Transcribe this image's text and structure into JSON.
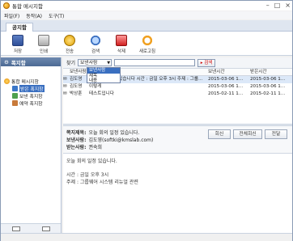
{
  "window": {
    "title": "통합 메시지함",
    "controls": [
      "–",
      "□",
      "×"
    ]
  },
  "menu": [
    "파일(F)",
    "동작(A)",
    "도구(T)"
  ],
  "tabs": [
    {
      "label": "공지함"
    }
  ],
  "toolbar": [
    {
      "label": "저장",
      "icon": "save-icon"
    },
    {
      "label": "인쇄",
      "icon": "print-icon"
    },
    {
      "label": "전송",
      "icon": "send-icon"
    },
    {
      "label": "검색",
      "icon": "search-icon"
    },
    {
      "label": "삭제",
      "icon": "delete-icon"
    },
    {
      "label": "새로고침",
      "icon": "refresh-icon"
    }
  ],
  "sidebar": {
    "title": "폭지함",
    "tree": {
      "root": "통합 메시지함",
      "items": [
        {
          "label": "받은 폭지함",
          "selected": true
        },
        {
          "label": "보낸 폭지함"
        },
        {
          "label": "예약 폭지함"
        }
      ]
    }
  },
  "search": {
    "label": "찾기",
    "selected": "보낸사람",
    "options": [
      "보낸사람",
      "제목",
      "내용"
    ],
    "button": "▸ 검색"
  },
  "table": {
    "columns": [
      "보낸사람",
      "제목",
      "보낸시간",
      "받은시간"
    ],
    "rows": [
      {
        "sender": "김도영",
        "subject": "오늘 회의 일정 있습니다 시간 : 금일 오후 3시 주제 : 그룹...",
        "sent": "2015-03-06 1...",
        "received": "2015-03-06 1...",
        "selected": true
      },
      {
        "sender": "김도영",
        "subject": "이렇게",
        "sent": "2015-03-06 1...",
        "received": "2015-03-06 1..."
      },
      {
        "sender": "박상훈",
        "subject": "테스트입니다",
        "sent": "2015-02-11 1...",
        "received": "2015-02-11 1..."
      }
    ]
  },
  "detail": {
    "subject_label": "쪽지제목:",
    "subject": "오늘 회의 일정 있습니다.",
    "sender_label": "보낸사람:",
    "sender": "김도영(softki@kmslab.com)",
    "receiver_label": "받는사람:",
    "receiver": "권숙희",
    "buttons": {
      "reply": "회신",
      "reply_all": "전체회신",
      "forward": "전달"
    },
    "body": [
      "오늘 회의 일정 있습니다.",
      "",
      "시간 : 금일 오후 3시",
      "주제 : 그룹웨어 시스템 리뉴얼 관련"
    ]
  }
}
